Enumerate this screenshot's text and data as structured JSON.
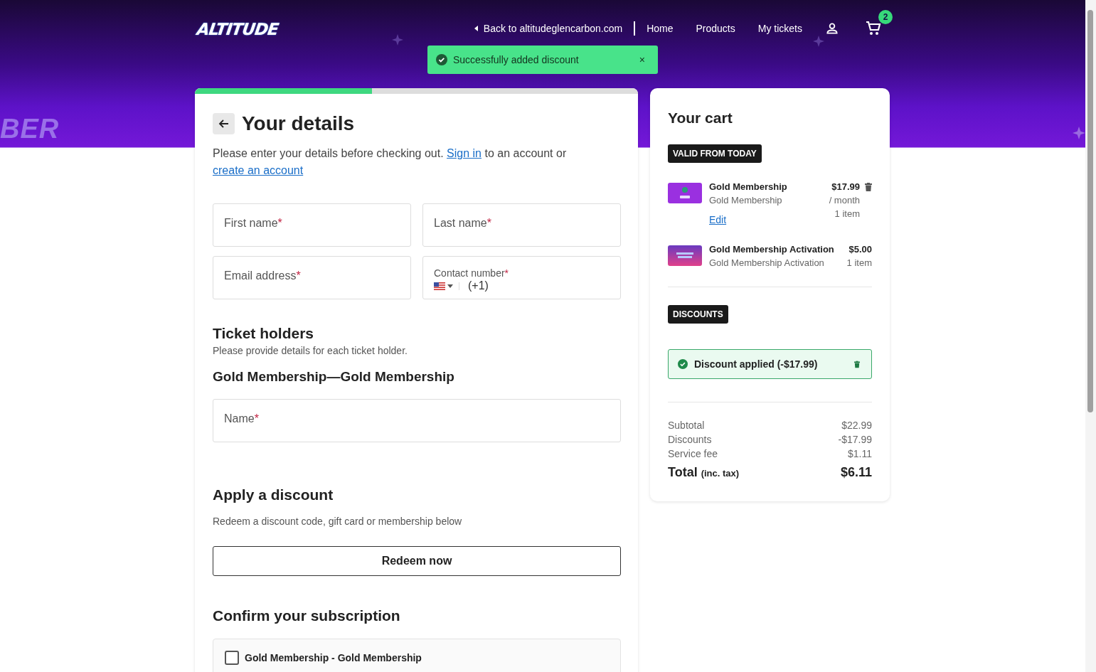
{
  "header": {
    "logo": "ALTITUDE",
    "hero_text": "BER",
    "back_link": "Back to altitudeglencarbon.com",
    "nav": [
      "Home",
      "Products",
      "My tickets"
    ],
    "cart_count": "2"
  },
  "toast": {
    "message": "Successfully added discount",
    "close": "×"
  },
  "details": {
    "progress": {
      "level": 0.4
    },
    "title": "Your details",
    "intro": [
      {
        "kind": "text",
        "text": "Please enter your details before checking out. "
      },
      {
        "kind": "link",
        "text": "Sign in"
      },
      {
        "kind": "text",
        "text": " to an account or "
      },
      {
        "kind": "link",
        "text": "create an account"
      }
    ],
    "fields": [
      {
        "kind": "text",
        "label": "First name",
        "mark": "*"
      },
      {
        "kind": "text",
        "label": "Last name",
        "mark": "*"
      },
      {
        "kind": "text",
        "label": "Email address",
        "mark": "*"
      },
      {
        "kind": "phone",
        "label": "Contact number",
        "mark": "*",
        "value": "(+1)"
      }
    ]
  },
  "ticket_holders": {
    "title": "Ticket holders",
    "subtitle": "Please provide details for each ticket holder.",
    "item_title": "Gold Membership—Gold Membership",
    "field": {
      "label": "Name",
      "mark": "*"
    }
  },
  "discount": {
    "title": "Apply a discount",
    "text": "Redeem a discount code, gift card or membership below",
    "button": "Redeem now"
  },
  "subscription": {
    "title": "Confirm your subscription",
    "items": [
      {
        "label": "Gold Membership - Gold Membership",
        "checked": false
      }
    ]
  },
  "cart": {
    "title": "Your cart",
    "section_label": "VALID FROM TODAY",
    "items": [
      {
        "kind": "gold",
        "name": "Gold Membership",
        "subtitle": "Gold Membership",
        "price": "$17.99",
        "period": "/ month",
        "quantity": "1 item",
        "edit": "Edit",
        "removable": true
      },
      {
        "kind": "activation",
        "name": "Gold Membership Activation",
        "subtitle": "Gold Membership Activation",
        "price": "$5.00",
        "quantity": "1 item",
        "removable": false
      }
    ],
    "discounts_label": "DISCOUNTS",
    "discount_applied": "Discount applied (-$17.99)",
    "totals": [
      {
        "label": "Subtotal",
        "value": "$22.99"
      },
      {
        "label": "Discounts",
        "value": "-$17.99"
      },
      {
        "label": "Service fee",
        "value": "$1.11"
      }
    ],
    "total": {
      "label": "Total",
      "note": "(inc. tax)",
      "value": "$6.11"
    }
  }
}
